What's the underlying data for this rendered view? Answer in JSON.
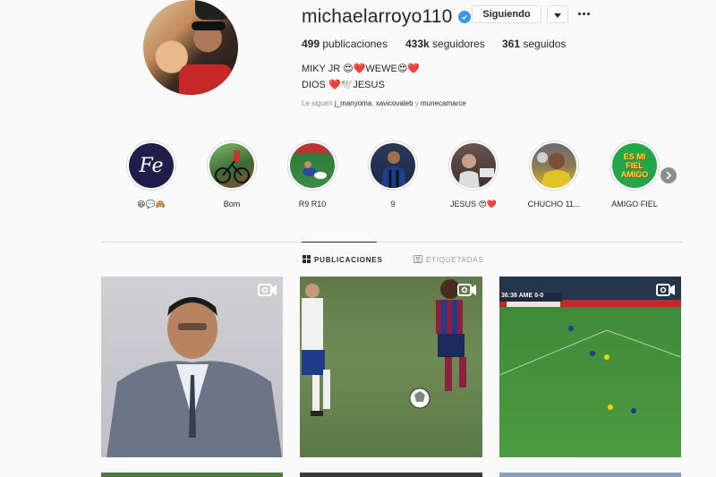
{
  "profile": {
    "username": "michaelarroyo110",
    "follow_button": "Siguiendo",
    "stats": {
      "posts": "499",
      "posts_label": "publicaciones",
      "followers": "433k",
      "followers_label": "seguidores",
      "following": "361",
      "following_label": "seguidos"
    },
    "bio_name": "MIKY JR 😍❤️WEWE😍❤️",
    "bio_line": "DIOS ❤️🕊️JESUS",
    "followed_by_prefix": "Le siguen",
    "followed_by": [
      "j_manyoma",
      "xavicovaleb",
      "munecamarce"
    ],
    "followed_by_sep1": ", ",
    "followed_by_sep2": " y "
  },
  "highlights": [
    {
      "label": "😆💬🙈",
      "icon": "fe-logo",
      "cover_text": "Fe"
    },
    {
      "label": "Bom",
      "icon": "bicycle-photo"
    },
    {
      "label": "R9 R10",
      "icon": "football-photo"
    },
    {
      "label": "9",
      "icon": "player-photo"
    },
    {
      "label": "JESUS 😍❤️",
      "icon": "person-photo"
    },
    {
      "label": "CHUCHO 11...",
      "icon": "player-photo"
    },
    {
      "label": "AMIGO FIEL",
      "icon": "text-graphic",
      "cover_text": "ES MI FIEL AMIGO"
    }
  ],
  "tabs": [
    {
      "label": "PUBLICACIONES",
      "icon": "grid-icon",
      "active": true
    },
    {
      "label": "ETIQUETADAS",
      "icon": "tag-icon",
      "active": false
    }
  ],
  "posts": [
    {
      "type": "video",
      "subject": "man-in-suit"
    },
    {
      "type": "video",
      "subject": "football-dribble"
    },
    {
      "type": "video",
      "subject": "football-broadcast",
      "scoreboard": "36:38 AME 0-0"
    }
  ],
  "colors": {
    "verified": "#3897f0",
    "text": "#262626",
    "muted": "#8e8e8e",
    "border": "#dbdbdb",
    "background": "#fafafa"
  }
}
